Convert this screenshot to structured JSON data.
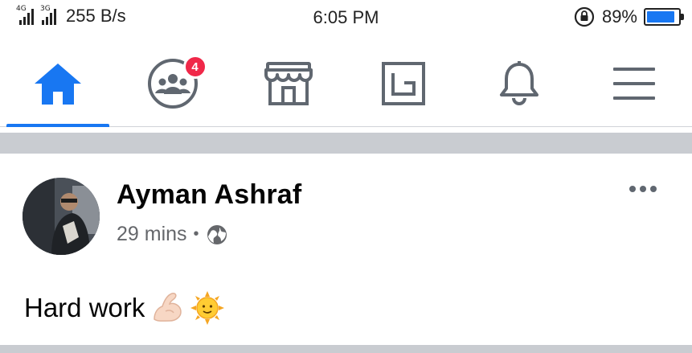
{
  "status_bar": {
    "signal_1_tag": "4G",
    "signal_2_tag": "3G",
    "net_speed": "255 B/s",
    "time": "6:05 PM",
    "battery_percent": "89%",
    "battery_level": 0.89
  },
  "tabs": [
    {
      "name": "home",
      "icon": "home-icon",
      "active": true
    },
    {
      "name": "groups",
      "icon": "groups-icon",
      "badge": "4"
    },
    {
      "name": "marketplace",
      "icon": "marketplace-icon"
    },
    {
      "name": "gaming",
      "icon": "gaming-icon"
    },
    {
      "name": "notifications",
      "icon": "bell-icon"
    },
    {
      "name": "menu",
      "icon": "hamburger-menu-icon"
    }
  ],
  "post": {
    "author": "Ayman Ashraf",
    "time": "29 mins",
    "separator": "•",
    "privacy_icon": "globe-icon",
    "text": "Hard work",
    "emojis": [
      "flexed-biceps-emoji",
      "sun-with-face-emoji"
    ]
  },
  "colors": {
    "accent": "#1877f2",
    "badge": "#f02849",
    "separator": "#c9ccd1",
    "secondary_text": "#65676b"
  }
}
